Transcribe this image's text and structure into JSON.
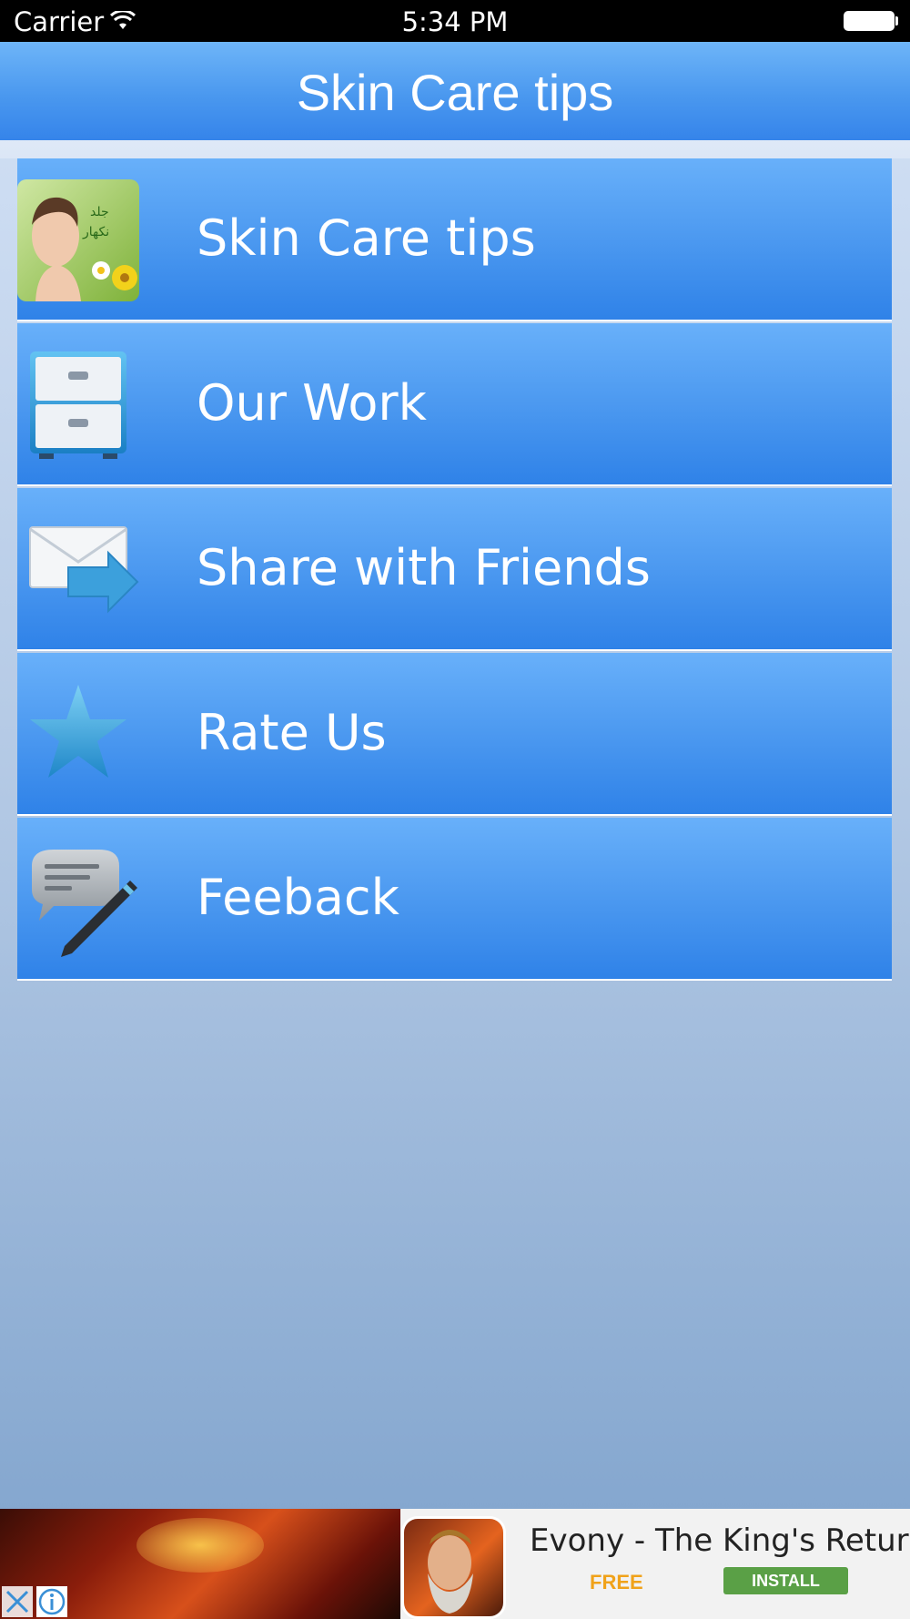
{
  "status_bar": {
    "carrier": "Carrier",
    "time": "5:34 PM"
  },
  "nav": {
    "title": "Skin Care tips"
  },
  "menu": {
    "items": [
      {
        "label": "Skin Care tips",
        "icon": "face-photo-icon"
      },
      {
        "label": "Our Work",
        "icon": "file-cabinet-icon"
      },
      {
        "label": "Share with Friends",
        "icon": "envelope-share-icon"
      },
      {
        "label": "Rate Us",
        "icon": "star-icon"
      },
      {
        "label": "Feeback",
        "icon": "chat-pencil-icon"
      }
    ]
  },
  "ad": {
    "title": "Evony - The King's Return",
    "price": "FREE",
    "install_label": "INSTALL"
  },
  "colors": {
    "nav_blue": "#4a98ef",
    "menu_blue": "#4c99f0",
    "install_green": "#5aa046",
    "free_orange": "#f0a21a"
  }
}
